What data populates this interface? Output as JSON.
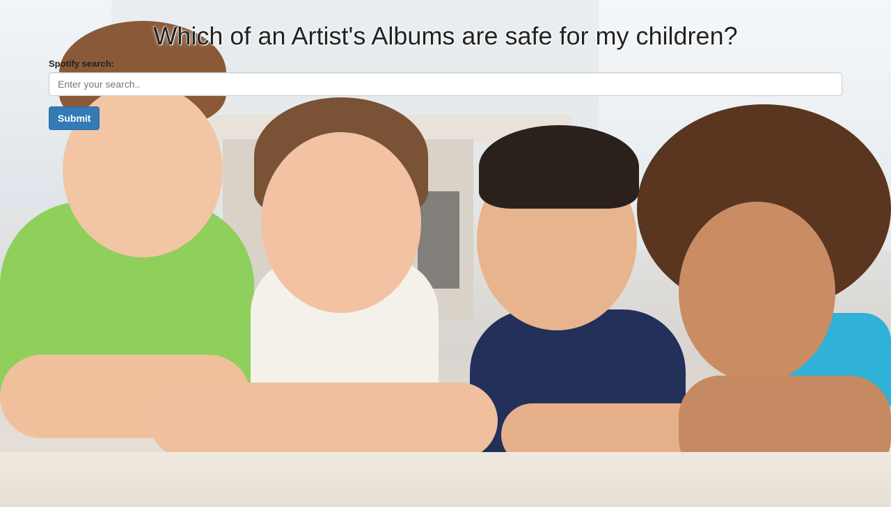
{
  "page": {
    "title": "Which of an Artist's Albums are safe for my children?"
  },
  "form": {
    "search_label": "Spotify search:",
    "search_placeholder": "Enter your search..",
    "search_value": "",
    "submit_label": "Submit"
  },
  "background": {
    "description_icon": "background-photo",
    "accent_color": "#337ab7"
  }
}
